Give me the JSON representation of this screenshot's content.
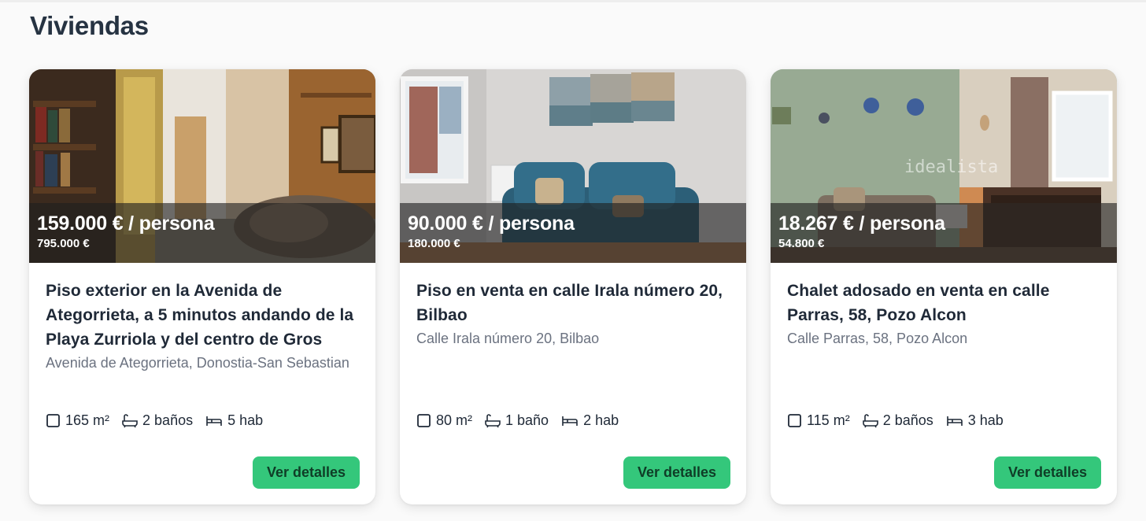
{
  "section": {
    "title": "Viviendas"
  },
  "cards": [
    {
      "price_per_person": "159.000 € / persona",
      "price_total": "795.000 €",
      "title": "Piso exterior en la Avenida de Ategorrieta, a 5 minutos andando de la Playa Zurriola y del centro de Gros",
      "address": "Avenida de Ategorrieta, Donostia-San Sebastian",
      "area": "165 m²",
      "baths": "2 baños",
      "rooms": "5 hab",
      "button": "Ver detalles"
    },
    {
      "price_per_person": "90.000 € / persona",
      "price_total": "180.000 €",
      "title": "Piso en venta en calle Irala número 20, Bilbao",
      "address": "Calle Irala número 20, Bilbao",
      "area": "80 m²",
      "baths": "1 baño",
      "rooms": "2 hab",
      "button": "Ver detalles"
    },
    {
      "price_per_person": "18.267 € / persona",
      "price_total": "54.800 €",
      "title": "Chalet adosado en venta en calle Parras, 58, Pozo Alcon",
      "address": "Calle Parras, 58, Pozo Alcon",
      "area": "115 m²",
      "baths": "2 baños",
      "rooms": "3 hab",
      "button": "Ver detalles",
      "watermark": "idealista"
    }
  ],
  "colors": {
    "accent_button": "#34c77b",
    "button_text": "#0f3d27",
    "title_text": "#1f2937",
    "address_text": "#6b7280"
  },
  "icons": {
    "area": "square-icon",
    "baths": "bathtub-icon",
    "rooms": "bed-icon"
  }
}
